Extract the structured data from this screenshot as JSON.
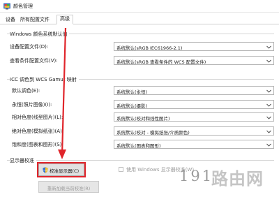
{
  "window": {
    "title": "颜色管理"
  },
  "tabs": [
    {
      "label": "设备",
      "active": false
    },
    {
      "label": "所有配置文件",
      "active": false
    },
    {
      "label": "高级",
      "active": true
    }
  ],
  "windows_defaults": {
    "title": "Windows 颜色系统默认值",
    "rows": [
      {
        "label": "设备配置文件(D):",
        "value": "系统默认(sRGB IEC61966-2.1)"
      },
      {
        "label": "查看条件配置文件(V):",
        "value": "系统默认(sRGB 查看条件的 WCS 配置文件)"
      }
    ]
  },
  "icc_mapping": {
    "title": "ICC 调色到 WCS Gamut 映射",
    "rows": [
      {
        "label": "默认调色(E):",
        "value": "系统默认(永恒)"
      },
      {
        "label": "永恒(照片图像)(I):",
        "value": "系统默认(摄影)"
      },
      {
        "label": "相对色度(线型图片)(L):",
        "value": "系统默认(校对和线性图片)"
      },
      {
        "label": "绝对色度(模拟纸张)(A):",
        "value": "系统默认(校对 - 模拟纸张/介质颜色)"
      },
      {
        "label": "饱和度(图表和图形)(S):",
        "value": "系统默认(图表和图形)"
      }
    ]
  },
  "display_calibration": {
    "title": "显示器校准",
    "calibrate_button": "校准显示器(C)",
    "checkbox_label": "使用 Windows 显示器校准(W)",
    "checkbox_checked": false,
    "reload_button": "重新加载当前校准(R)"
  },
  "watermark": {
    "number": "191",
    "name": "路由网"
  },
  "colors": {
    "highlight": "#e0252b",
    "arrow": "#e0252b",
    "select_border": "#b4b4b4"
  },
  "icons": {
    "app": "color-management-icon",
    "shield": "uac-shield-icon",
    "chevron": "chevron-down-icon"
  }
}
